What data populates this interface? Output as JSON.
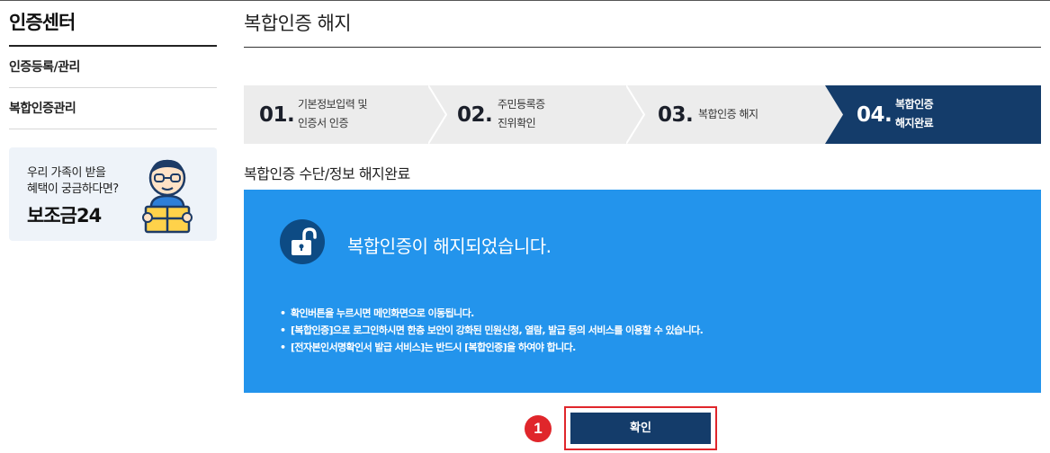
{
  "sidebar": {
    "title": "인증센터",
    "items": [
      {
        "label": "인증등록/관리"
      },
      {
        "label": "복합인증관리"
      }
    ],
    "banner": {
      "line1": "우리 가족이 받을",
      "line2": "혜택이 궁금하다면?",
      "brand": "보조금24"
    }
  },
  "main": {
    "title": "복합인증 해지",
    "steps": [
      {
        "num": "01.",
        "line1": "기본정보입력 및",
        "line2": "인증서 인증",
        "active": false
      },
      {
        "num": "02.",
        "line1": "주민등록증",
        "line2": "진위확인",
        "active": false
      },
      {
        "num": "03.",
        "line1": "복합인증 해지",
        "line2": "",
        "active": false
      },
      {
        "num": "04.",
        "line1": "복합인증",
        "line2": "해지완료",
        "active": true
      }
    ],
    "section_title": "복합인증 수단/정보 해지완료",
    "notice": {
      "headline": "복합인증이 해지되었습니다.",
      "bullets": [
        "확인버튼을 누르시면 메인화면으로 이동됩니다.",
        "[복합인증]으로 로그인하시면 한층 보안이 강화된 민원신청, 열람, 발급 등의 서비스를 이용할 수 있습니다.",
        "[전자본인서명확인서 발급 서비스]는 반드시 [복합인증]을 하여야 합니다."
      ]
    },
    "confirm_label": "확인",
    "callout_number": "1"
  },
  "colors": {
    "navy": "#143c6a",
    "notice_blue": "#2394ec",
    "lock_circle": "#0d4b84",
    "step_bg": "#ececec",
    "callout_red": "#e0262b"
  },
  "icons": {
    "lock": "unlocked-padlock-icon",
    "banner": "person-holding-gift-icon"
  }
}
